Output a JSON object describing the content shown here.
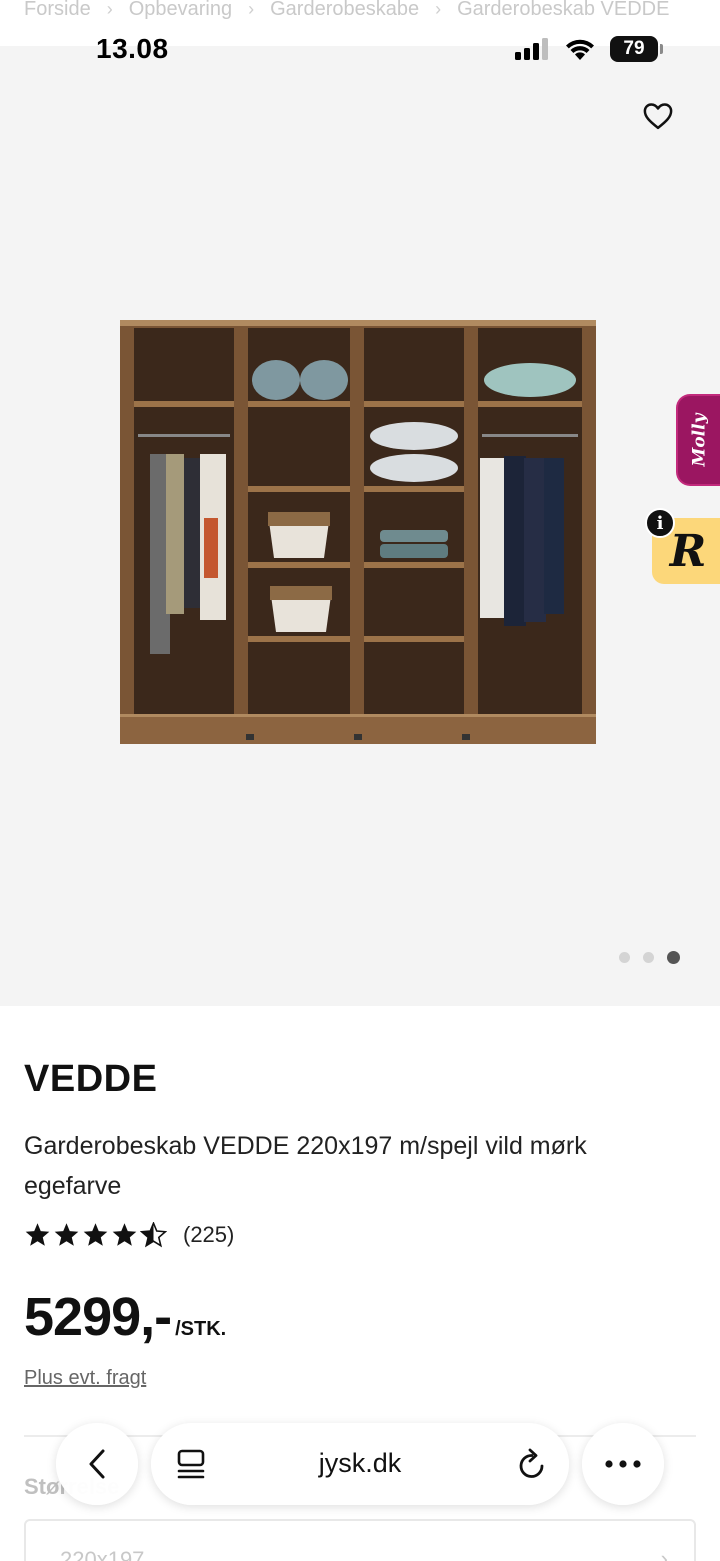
{
  "breadcrumb": [
    "Forside",
    "Opbevaring",
    "Garderobeskabe",
    "Garderobeskab VEDDE"
  ],
  "status_bar": {
    "time": "13.08",
    "battery": "79"
  },
  "gallery": {
    "image_count": 3,
    "active_index": 2
  },
  "widgets": {
    "molly_label": "Molly",
    "r_label": "R",
    "info_label": "i"
  },
  "product": {
    "brand": "VEDDE",
    "title": "Garderobeskab VEDDE 220x197 m/spejl vild mørk egefarve",
    "rating": 4.5,
    "review_count": "(225)",
    "price": "5299,-",
    "price_unit": "/STK.",
    "shipping_note": "Plus evt. fragt",
    "size_label": "Størrelse",
    "size_value": "220x197"
  },
  "browser": {
    "url": "jysk.dk"
  },
  "colors": {
    "molly": "#9b1661",
    "r_widget": "#fcd77a",
    "gallery_bg": "#f4f4f4"
  },
  "icons": [
    "heart-icon",
    "back-chevron-icon",
    "tabs-icon",
    "reload-icon",
    "more-dots-icon",
    "star-icon",
    "signal-icon",
    "wifi-icon",
    "battery-icon"
  ]
}
